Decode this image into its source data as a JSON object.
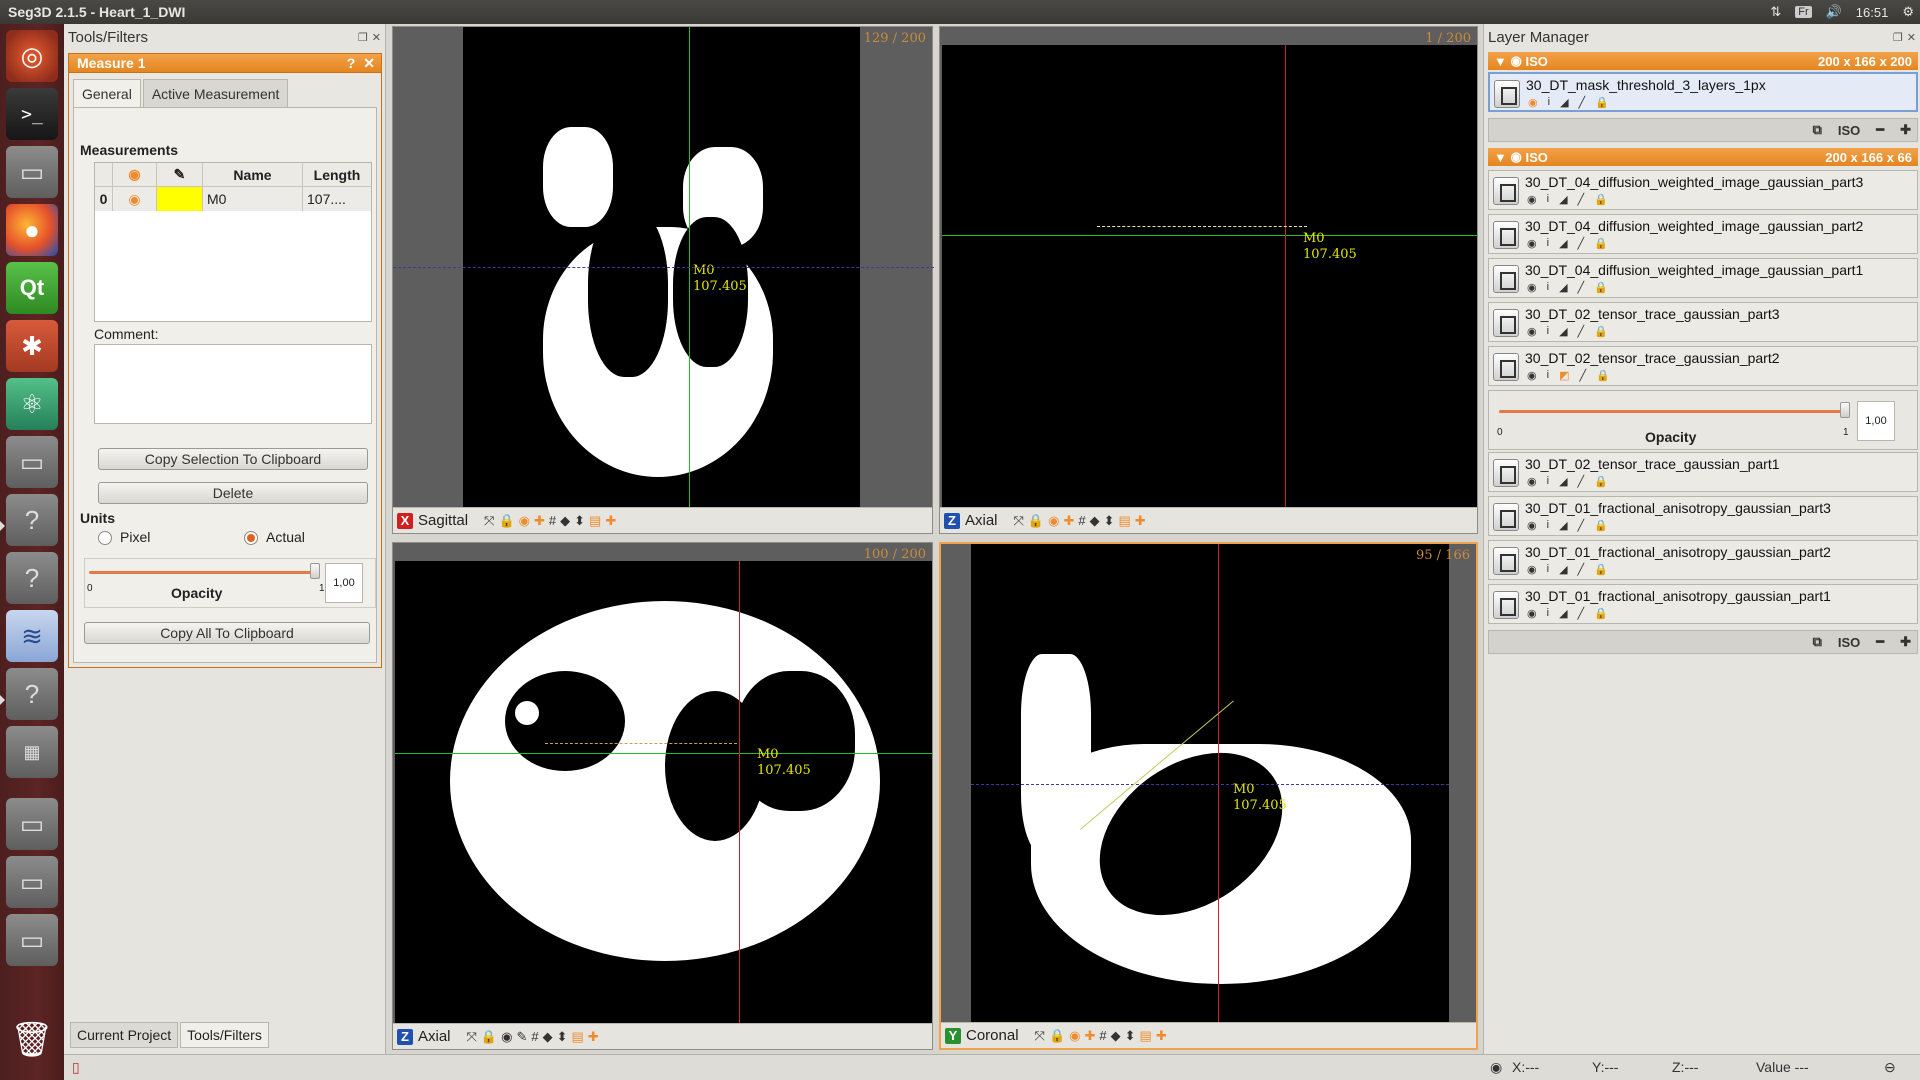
{
  "window": {
    "title": "Seg3D  2.1.5 - Heart_1_DWI"
  },
  "tray": {
    "keyboard": "Fr",
    "time": "16:51"
  },
  "tools_panel": {
    "title": "Tools/Filters",
    "tool_title": "Measure 1",
    "tool_help": "?",
    "tool_close": "✕",
    "tabs": [
      "General",
      "Active Measurement"
    ],
    "measurements_label": "Measurements",
    "table": {
      "headers": [
        "",
        "",
        "Name",
        "Length"
      ],
      "rows": [
        {
          "index": "0",
          "name": "M0",
          "length": "107...."
        }
      ],
      "color": "#ffff00"
    },
    "comment_label": "Comment:",
    "copy_selection_label": "Copy Selection To Clipboard",
    "delete_label": "Delete",
    "units_label": "Units",
    "unit_pixel": "Pixel",
    "unit_actual": "Actual",
    "selected_unit": "Actual",
    "opacity_label": "Opacity",
    "opacity_min": "0",
    "opacity_max": "1",
    "opacity_value": "1,00",
    "opacity_fraction": 1.0,
    "copy_all_label": "Copy All To Clipboard",
    "bottom_tabs": [
      "Current Project",
      "Tools/Filters"
    ]
  },
  "viewers": [
    {
      "id": "tl",
      "axis": "X",
      "name": "Sagittal",
      "slice": "129 / 200",
      "axis_color": "#d02020",
      "measure_name": "M0",
      "measure_value": "107.405"
    },
    {
      "id": "tr",
      "axis": "Z",
      "name": "Axial",
      "slice": "1 / 200",
      "axis_color": "#2050b0",
      "measure_name": "M0",
      "measure_value": "107.405"
    },
    {
      "id": "bl",
      "axis": "Z",
      "name": "Axial",
      "slice": "100 / 200",
      "axis_color": "#2050b0",
      "measure_name": "M0",
      "measure_value": "107.405"
    },
    {
      "id": "br",
      "axis": "Y",
      "name": "Coronal",
      "slice": "95 / 166",
      "axis_color": "#2a9030",
      "measure_name": "M0",
      "measure_value": "107.405"
    }
  ],
  "layer_manager": {
    "title": "Layer Manager",
    "groups": [
      {
        "tag": "ISO",
        "dims": "200 x 166 x 200",
        "layers": [
          "30_DT_mask_threshold_3_layers_1px"
        ]
      },
      {
        "tag": "ISO",
        "dims": "200 x 166 x 66",
        "layers": [
          "30_DT_04_diffusion_weighted_image_gaussian_part3",
          "30_DT_04_diffusion_weighted_image_gaussian_part2",
          "30_DT_04_diffusion_weighted_image_gaussian_part1",
          "30_DT_02_tensor_trace_gaussian_part3",
          "30_DT_02_tensor_trace_gaussian_part2",
          "30_DT_02_tensor_trace_gaussian_part1",
          "30_DT_01_fractional_anisotropy_gaussian_part3",
          "30_DT_01_fractional_anisotropy_gaussian_part2",
          "30_DT_01_fractional_anisotropy_gaussian_part1"
        ]
      }
    ],
    "footer_iso": "ISO",
    "layer_opacity": {
      "label": "Opacity",
      "min": "0",
      "max": "1",
      "value": "1,00",
      "fraction": 1.0
    }
  },
  "status": {
    "x": "X:---",
    "y": "Y:---",
    "z": "Z:---",
    "value": "Value ---"
  }
}
